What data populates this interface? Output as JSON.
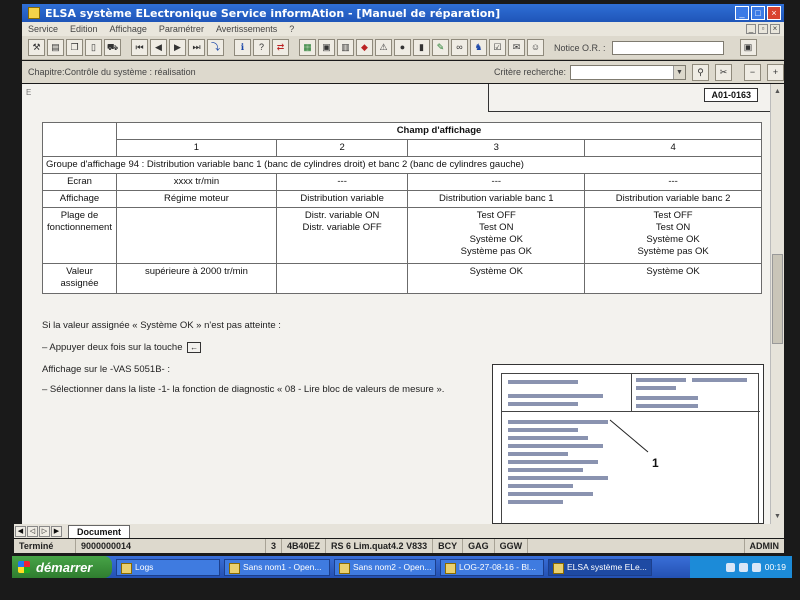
{
  "window": {
    "title": "ELSA système ELectronique Service informAtion - [Manuel de réparation]"
  },
  "menu": {
    "items": [
      "Service",
      "Edition",
      "Affichage",
      "Paramétrer",
      "Avertissements",
      "?"
    ]
  },
  "toolbar": {
    "notice_label": "Notice O.R. :"
  },
  "chapter": {
    "label": "Chapitre:Contrôle du système : réalisation",
    "search_label": "Critère recherche:"
  },
  "document": {
    "figure_code": "A01-0163",
    "table": {
      "header_title": "Champ d'affichage",
      "columns": [
        "1",
        "2",
        "3",
        "4"
      ],
      "group_row": "Groupe d'affichage 94 : Distribution variable banc 1 (banc de cylindres droit) et banc 2 (banc de cylindres gauche)",
      "rows": [
        {
          "label": "Ecran",
          "cells": [
            "xxxx tr/min",
            "---",
            "---",
            "---"
          ]
        },
        {
          "label": "Affichage",
          "cells": [
            "Régime moteur",
            "Distribution variable",
            "Distribution variable banc 1",
            "Distribution variable banc 2"
          ]
        },
        {
          "label": "Plage de fonctionnement",
          "cells": [
            "",
            "Distr. variable ON\nDistr. variable OFF",
            "Test OFF\nTest ON\nSystème OK\nSystème pas OK",
            "Test OFF\nTest ON\nSystème OK\nSystème pas OK"
          ]
        },
        {
          "label": "Valeur assignée",
          "cells": [
            "supérieure à 2000 tr/min",
            "",
            "Système OK",
            "Système OK"
          ]
        }
      ]
    },
    "para1": "Si la valeur assignée « Système OK » n'est pas atteinte :",
    "para2": "–   Appuyer deux fois sur la touche",
    "key_glyph": "←",
    "para3": "Affichage sur le -VAS 5051B- :",
    "para4": "–   Sélectionner dans la liste -1- la fonction de diagnostic « 08 - Lire bloc de valeurs de mesure ».",
    "callout": "1"
  },
  "tabs": {
    "document": "Document"
  },
  "status": {
    "state": "Terminé",
    "number": "9000000014",
    "vehicle": [
      "3",
      "4B40EZ",
      "RS 6 Lim.quat4.2 V833",
      "BCY",
      "GAG",
      "GGW"
    ],
    "user": "ADMIN"
  },
  "taskbar": {
    "start": "démarrer",
    "tasks": [
      "Logs",
      "Sans nom1 - Open...",
      "Sans nom2 - Open...",
      "LOG-27-08-16 - Bl...",
      "ELSA système ELe..."
    ],
    "clock": "00:19"
  }
}
